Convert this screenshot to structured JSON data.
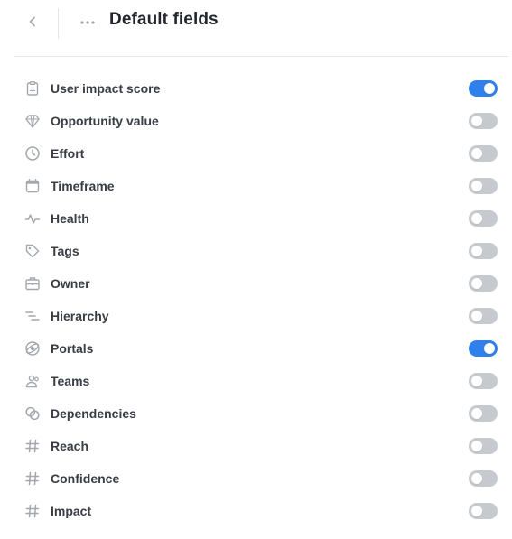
{
  "header": {
    "title": "Default fields",
    "back_icon": "chevron-left-icon",
    "more_icon": "more-horizontal-icon"
  },
  "colors": {
    "toggle_on": "#2f80ed",
    "toggle_off": "#c6c9ce",
    "icon": "#a3a7ae"
  },
  "fields": [
    {
      "label": "User impact score",
      "icon": "clipboard-icon",
      "enabled": true
    },
    {
      "label": "Opportunity value",
      "icon": "diamond-icon",
      "enabled": false
    },
    {
      "label": "Effort",
      "icon": "clock-icon",
      "enabled": false
    },
    {
      "label": "Timeframe",
      "icon": "calendar-icon",
      "enabled": false
    },
    {
      "label": "Health",
      "icon": "pulse-icon",
      "enabled": false
    },
    {
      "label": "Tags",
      "icon": "tag-icon",
      "enabled": false
    },
    {
      "label": "Owner",
      "icon": "briefcase-icon",
      "enabled": false
    },
    {
      "label": "Hierarchy",
      "icon": "hierarchy-icon",
      "enabled": false
    },
    {
      "label": "Portals",
      "icon": "portal-icon",
      "enabled": true
    },
    {
      "label": "Teams",
      "icon": "teams-icon",
      "enabled": false
    },
    {
      "label": "Dependencies",
      "icon": "link-icon",
      "enabled": false
    },
    {
      "label": "Reach",
      "icon": "hash-icon",
      "enabled": false
    },
    {
      "label": "Confidence",
      "icon": "hash-icon",
      "enabled": false
    },
    {
      "label": "Impact",
      "icon": "hash-icon",
      "enabled": false
    }
  ]
}
